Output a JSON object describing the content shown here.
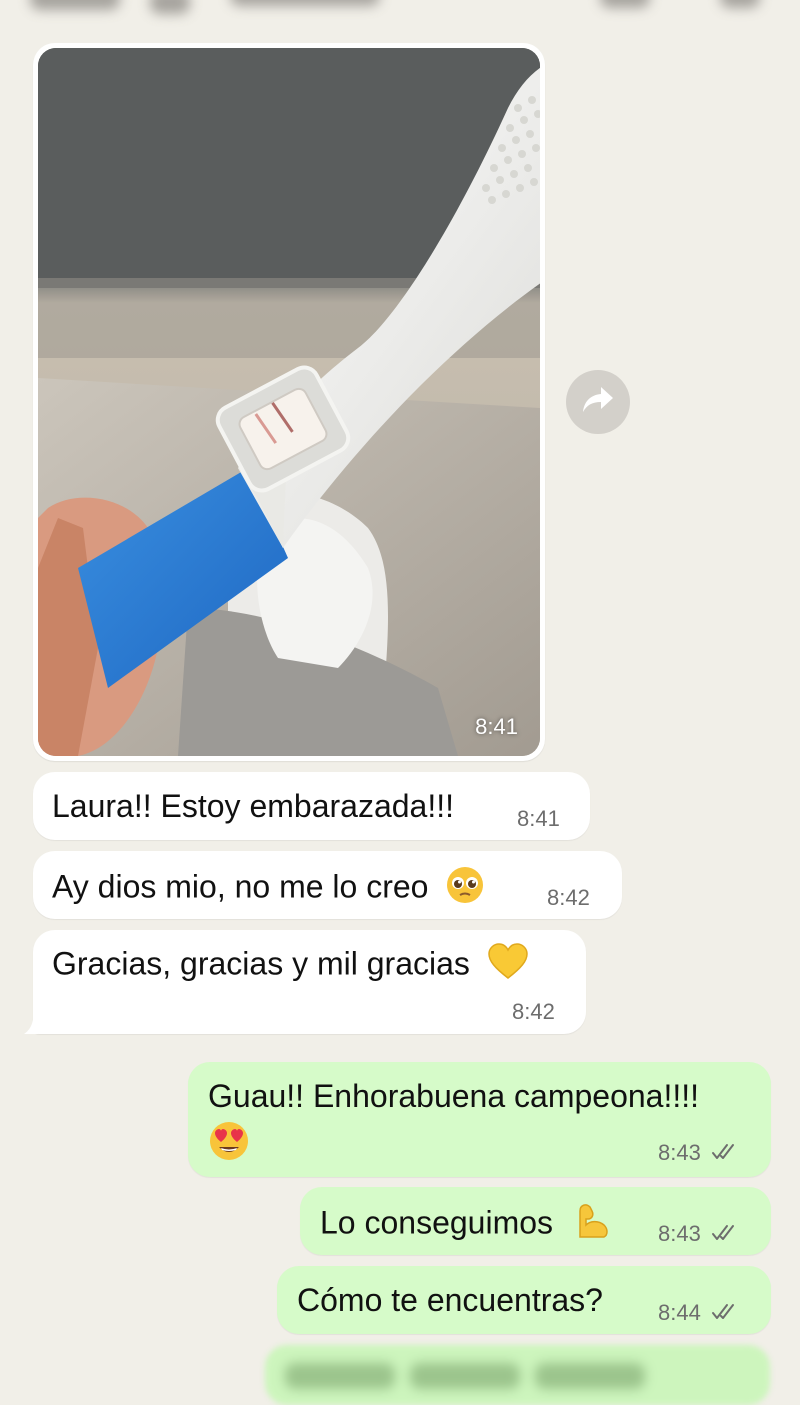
{
  "chat": {
    "image_message": {
      "time": "8:41"
    },
    "messages": [
      {
        "direction": "incoming",
        "text": "Laura!! Estoy embarazada!!!",
        "time": "8:41"
      },
      {
        "direction": "incoming",
        "text": "Ay dios mio, no me lo creo",
        "emoji": "pleading-face",
        "time": "8:42"
      },
      {
        "direction": "incoming",
        "text": "Gracias, gracias y mil gracias",
        "emoji": "yellow-heart",
        "time": "8:42"
      },
      {
        "direction": "outgoing",
        "text": "Guau!! Enhorabuena campeona!!!!",
        "emoji": "heart-eyes-face",
        "time": "8:43",
        "status": "read"
      },
      {
        "direction": "outgoing",
        "text": "Lo conseguimos",
        "emoji": "flexed-biceps",
        "time": "8:43",
        "status": "read"
      },
      {
        "direction": "outgoing",
        "text": "Cómo te encuentras?",
        "time": "8:44",
        "status": "read"
      }
    ]
  },
  "colors": {
    "background": "#f1efe8",
    "incoming_bubble": "#ffffff",
    "outgoing_bubble": "#d6fbc9",
    "timestamp": "#6d6d6d"
  }
}
